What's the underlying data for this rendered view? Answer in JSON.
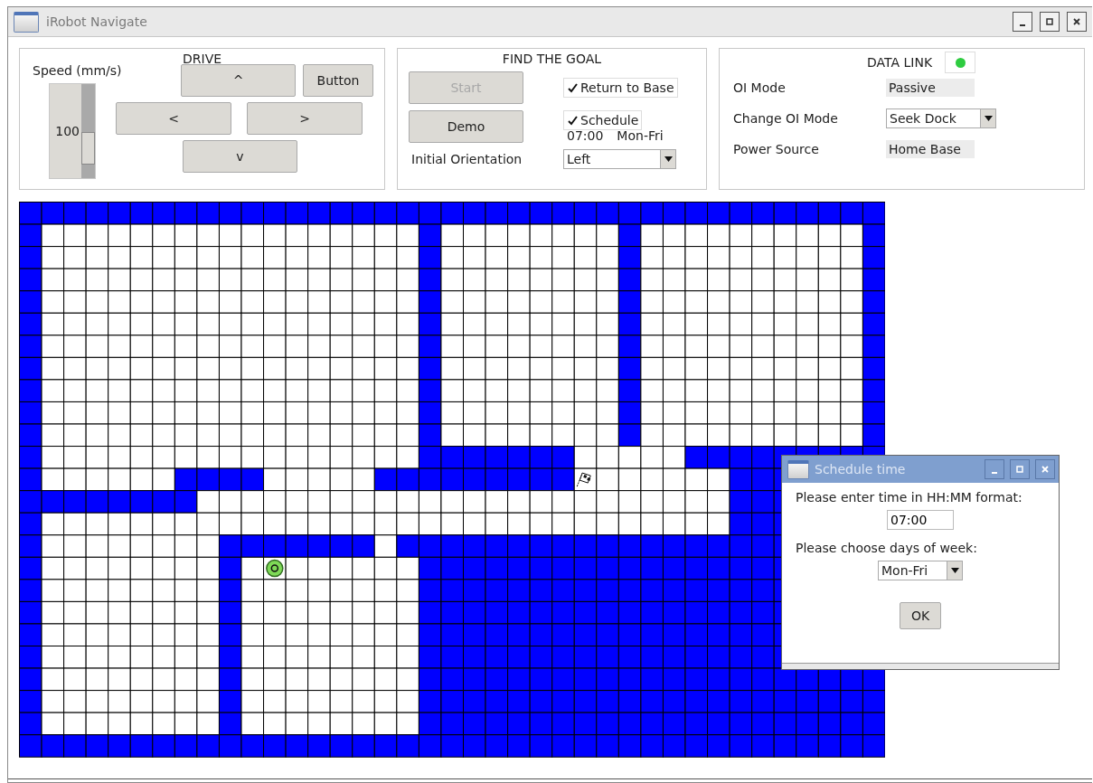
{
  "window": {
    "title": "iRobot Navigate"
  },
  "drive": {
    "speed_label": "Speed (mm/s)",
    "speed_value": "100",
    "level": 0.75,
    "title": "DRIVE",
    "buttons": [
      {
        "label": "^"
      },
      {
        "label": "Button"
      },
      {
        "label": "<"
      },
      {
        "label": ">"
      },
      {
        "label": "v"
      }
    ]
  },
  "find_goal": {
    "title": "FIND THE GOAL",
    "buttons": [
      {
        "label": "Start",
        "disabled": true
      },
      {
        "label": "Demo",
        "disabled": false
      }
    ],
    "checkboxes": [
      {
        "label": "Return to Base",
        "checked": true
      },
      {
        "label": "Schedule",
        "checked": true
      }
    ],
    "schedule_time": "07:00",
    "schedule_days": "Mon-Fri",
    "orientation_label": "Initial Orientation",
    "orientation_value": "Left"
  },
  "data_link": {
    "title": "DATA LINK",
    "connected": true,
    "rows": [
      {
        "kind": "readout",
        "label": "OI Mode",
        "value": "Passive"
      },
      {
        "kind": "dropdown",
        "label": "Change OI Mode",
        "value": "Seek Dock"
      },
      {
        "kind": "readout",
        "label": "Power Source",
        "value": "Home Base"
      }
    ]
  },
  "dialog": {
    "title": "Schedule time",
    "time_prompt": "Please enter time in HH:MM format:",
    "time_value": "07:00",
    "days_prompt": "Please choose days of week:",
    "days_value": "Mon-Fri",
    "ok": "OK"
  }
}
